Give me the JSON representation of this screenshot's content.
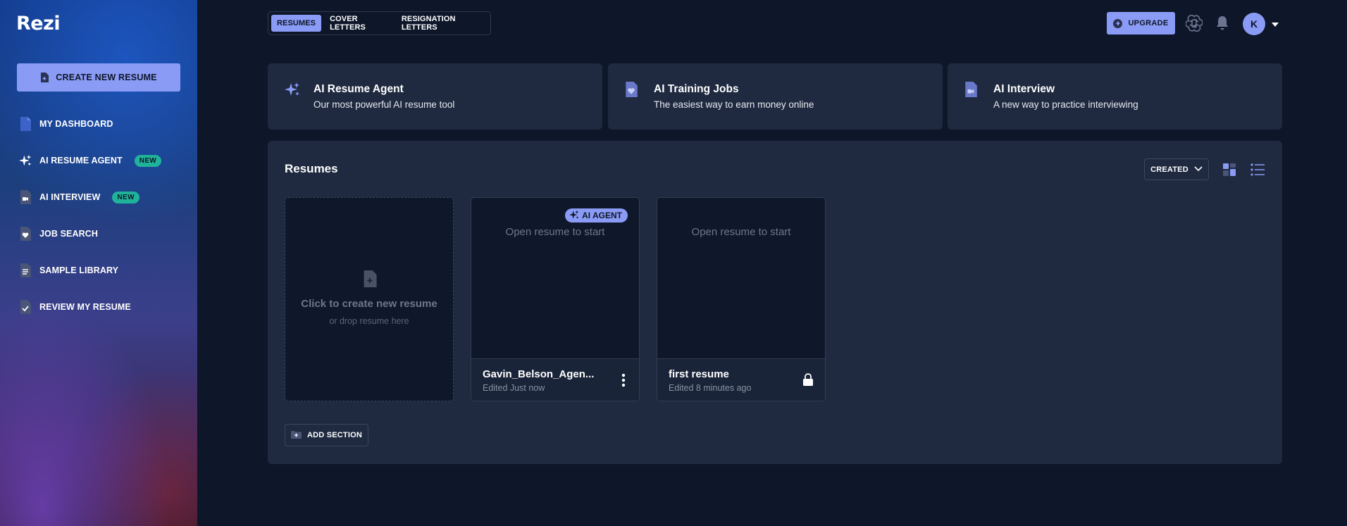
{
  "app": {
    "logo": "Rezi"
  },
  "sidebar": {
    "create_label": "CREATE NEW RESUME",
    "items": [
      {
        "label": "MY DASHBOARD",
        "icon": "document-icon",
        "badge": ""
      },
      {
        "label": "AI RESUME AGENT",
        "icon": "sparkle-icon",
        "badge": "NEW"
      },
      {
        "label": "AI INTERVIEW",
        "icon": "video-document-icon",
        "badge": "NEW"
      },
      {
        "label": "JOB SEARCH",
        "icon": "heart-document-icon",
        "badge": ""
      },
      {
        "label": "SAMPLE LIBRARY",
        "icon": "list-document-icon",
        "badge": ""
      },
      {
        "label": "REVIEW MY RESUME",
        "icon": "check-document-icon",
        "badge": ""
      }
    ]
  },
  "topbar": {
    "tabs": [
      {
        "label": "RESUMES",
        "active": true
      },
      {
        "label": "COVER LETTERS",
        "active": false
      },
      {
        "label": "RESIGNATION LETTERS",
        "active": false
      }
    ],
    "upgrade_label": "UPGRADE",
    "avatar_initial": "K"
  },
  "features": [
    {
      "title": "AI Resume Agent",
      "subtitle": "Our most powerful AI resume tool",
      "icon": "sparkle-icon"
    },
    {
      "title": "AI Training Jobs",
      "subtitle": "The easiest way to earn money online",
      "icon": "heart-document-icon"
    },
    {
      "title": "AI Interview",
      "subtitle": "A new way to practice interviewing",
      "icon": "video-document-icon"
    }
  ],
  "resumes": {
    "title": "Resumes",
    "sort_label": "CREATED",
    "new_card": {
      "title": "Click to create new resume",
      "subtitle": "or drop resume here"
    },
    "cards": [
      {
        "preview_text": "Open resume to start",
        "name": "Gavin_Belson_Agen...",
        "edited": "Edited Just now",
        "badge": "AI AGENT"
      },
      {
        "preview_text": "Open resume to start",
        "name": "first resume",
        "edited": "Edited 8 minutes ago",
        "badge": ""
      }
    ],
    "add_section_label": "ADD SECTION"
  },
  "colors": {
    "accent": "#8a9bf5",
    "background": "#0e1629",
    "panel": "#1f2a40",
    "new_badge": "#1fb39a"
  }
}
